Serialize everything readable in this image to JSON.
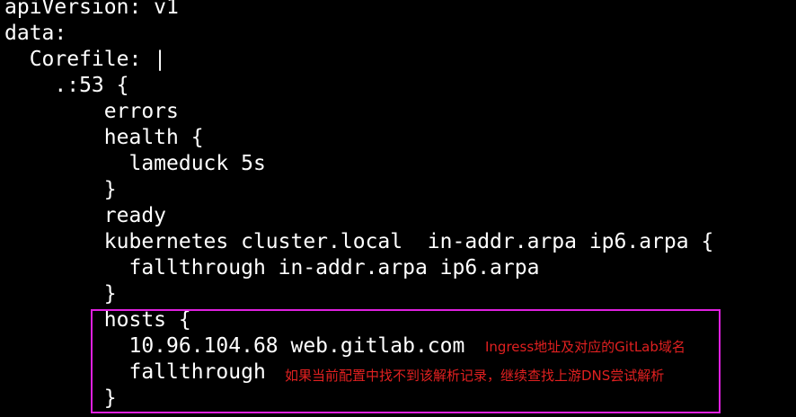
{
  "terminal": {
    "background": "#000000",
    "text_color": "#ffffff",
    "lines": [
      "apiVersion: v1",
      "data:",
      "  Corefile: |",
      "    .:53 {",
      "        errors",
      "        health {",
      "          lameduck 5s",
      "        }",
      "        ready",
      "        kubernetes cluster.local  in-addr.arpa ip6.arpa {",
      "          fallthrough in-addr.arpa ip6.arpa",
      "        }",
      "        hosts {",
      "          10.96.104.68 web.gitlab.com",
      "          fallthrough",
      "        }"
    ]
  },
  "highlight": {
    "border_color": "#e020e0"
  },
  "annotations": {
    "color": "#e02020",
    "hosts_entry_note": "Ingress地址及对应的GitLab域名",
    "fallthrough_note": "如果当前配置中找不到该解析记录，继续查找上游DNS尝试解析"
  }
}
